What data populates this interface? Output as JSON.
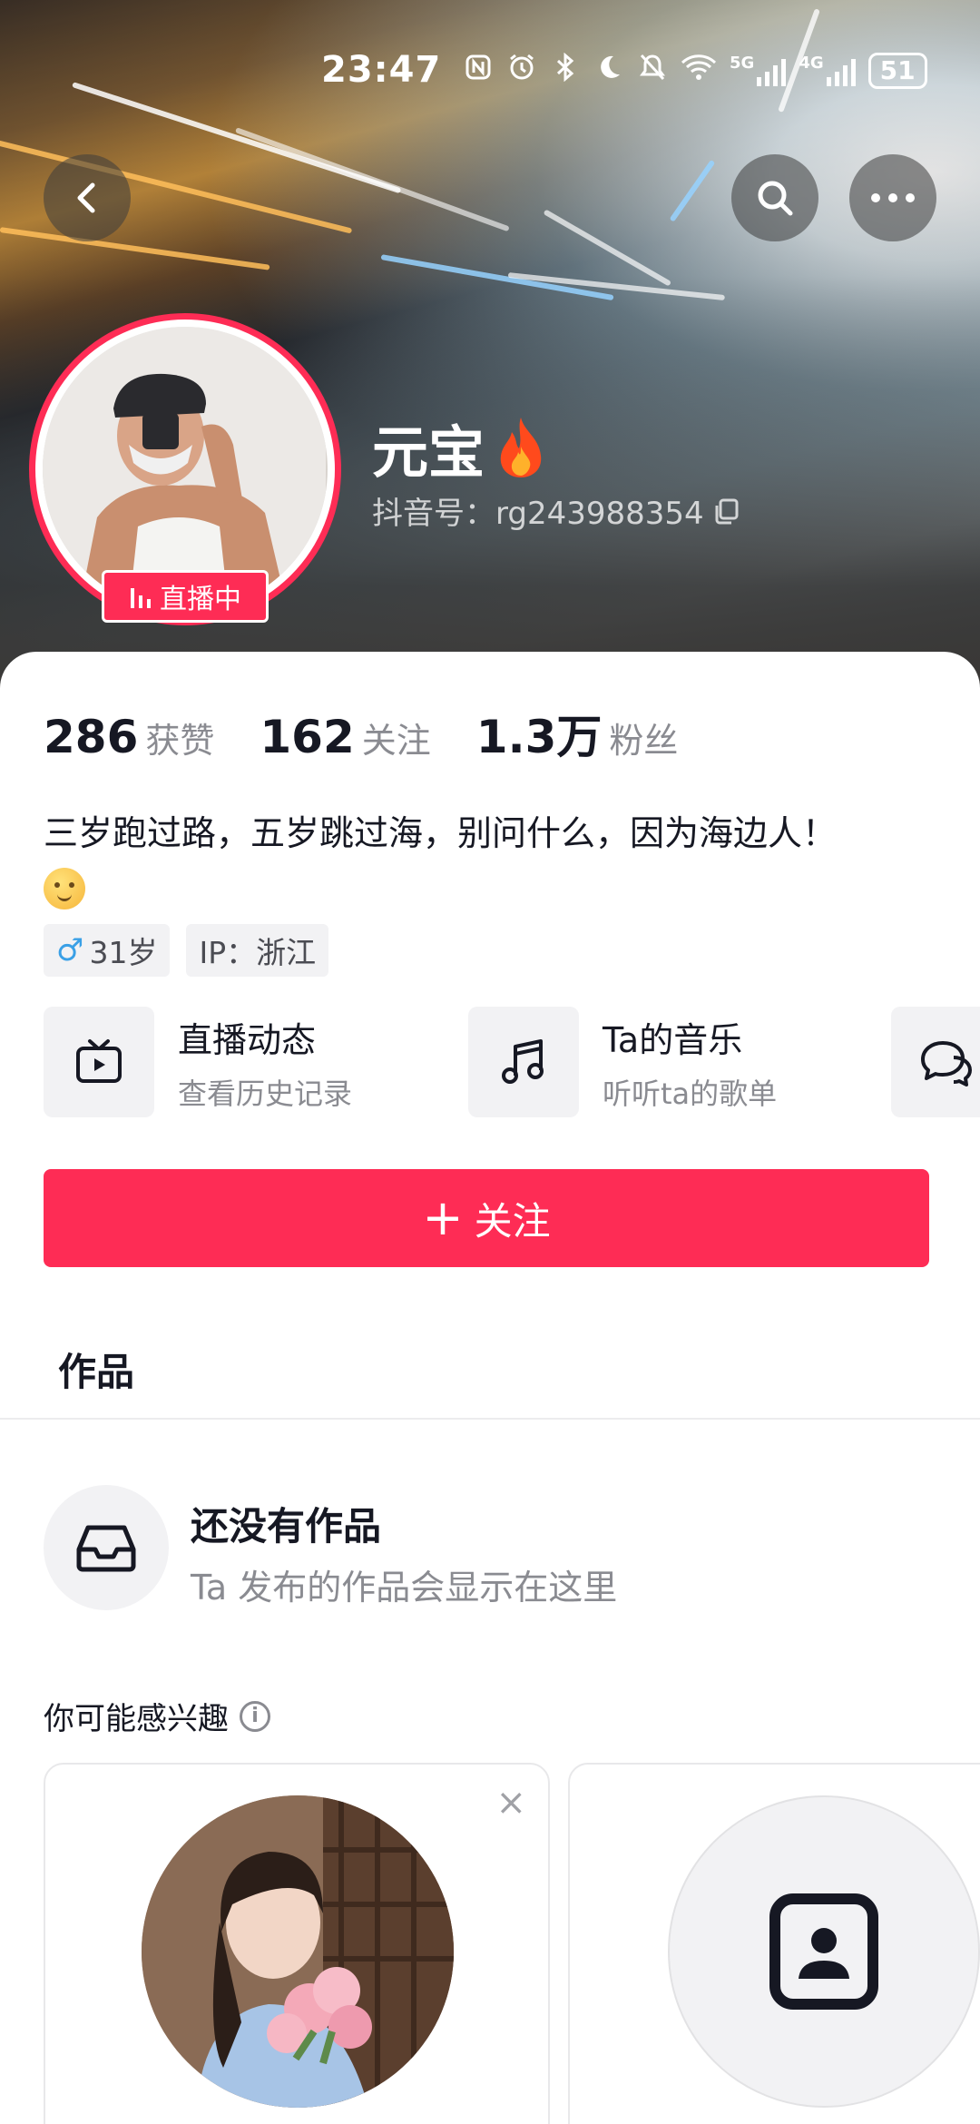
{
  "status_bar": {
    "time": "23:47",
    "icons": [
      "nfc-icon",
      "alarm-icon",
      "bluetooth-icon",
      "moon-icon",
      "mute-icon",
      "wifi-icon",
      "signal-5g-icon",
      "signal-4g-icon"
    ],
    "net1": "5G",
    "net2": "4G",
    "battery": "51"
  },
  "header": {
    "nickname": "元宝",
    "douyin_id": "抖音号：rg243988354",
    "live_badge": "直播中"
  },
  "stats": [
    {
      "value": "286",
      "label": "获赞"
    },
    {
      "value": "162",
      "label": "关注"
    },
    {
      "value": "1.3万",
      "label": "粉丝"
    }
  ],
  "bio": "三岁跑过路，五岁跳过海，别问什么，因为海边人！",
  "tags": {
    "gender_symbol": "♂",
    "age": "31岁",
    "ip": "IP：浙江"
  },
  "features": [
    {
      "title": "直播动态",
      "subtitle": "查看历史记录",
      "icon": "tv-icon"
    },
    {
      "title": "Ta的音乐",
      "subtitle": "听听ta的歌单",
      "icon": "music-icon"
    },
    {
      "title": "",
      "subtitle": "",
      "icon": "chat-icon"
    }
  ],
  "follow_button": {
    "plus": "+",
    "label": "关注"
  },
  "tabs": {
    "works": "作品"
  },
  "empty_state": {
    "title": "还没有作品",
    "subtitle": "Ta 发布的作品会显示在这里"
  },
  "recommend": {
    "title": "你可能感兴趣",
    "info_symbol": "i",
    "close_symbol": "×"
  },
  "colors": {
    "accent": "#fe2c55",
    "text_primary": "#161823",
    "text_secondary": "#8a8b91"
  }
}
